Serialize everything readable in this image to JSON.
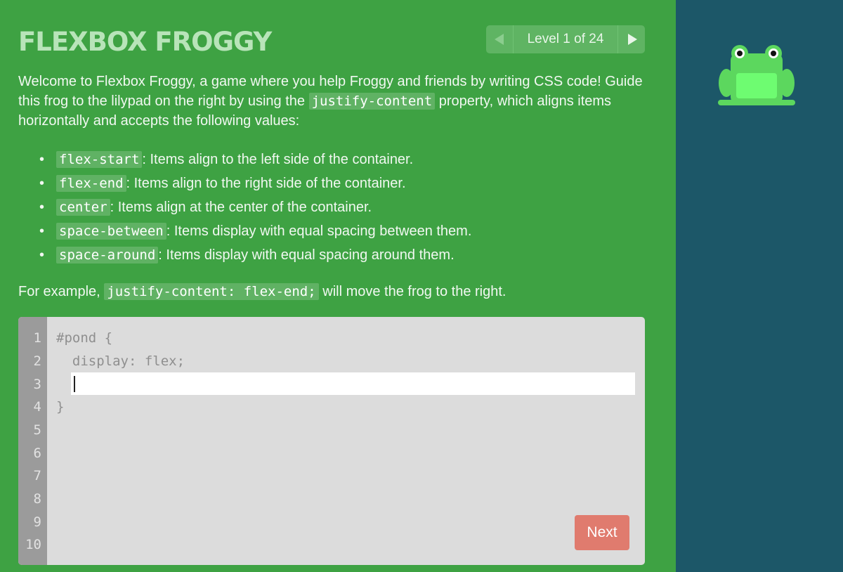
{
  "header": {
    "title": "FLEXBOX FROGGY",
    "level_label": "Level 1 of 24",
    "prev_icon": "triangle-left-icon",
    "next_icon": "triangle-right-icon"
  },
  "instructions": {
    "intro_1": "Welcome to Flexbox Froggy, a game where you help Froggy and friends by writing CSS code! Guide this frog to the lilypad on the right by using the ",
    "intro_code": "justify-content",
    "intro_2": " property, which aligns items horizontally and accepts the following values:",
    "values": [
      {
        "code": "flex-start",
        "text": ": Items align to the left side of the container."
      },
      {
        "code": "flex-end",
        "text": ": Items align to the right side of the container."
      },
      {
        "code": "center",
        "text": ": Items align at the center of the container."
      },
      {
        "code": "space-between",
        "text": ": Items display with equal spacing between them."
      },
      {
        "code": "space-around",
        "text": ": Items display with equal spacing around them."
      }
    ],
    "bullet": "•",
    "example_1": "For example, ",
    "example_code": "justify-content: flex-end;",
    "example_2": " will move the frog to the right."
  },
  "editor": {
    "line_numbers": [
      "1",
      "2",
      "3",
      "4",
      "5",
      "6",
      "7",
      "8",
      "9",
      "10"
    ],
    "line_1": "#pond {",
    "line_2": "  display: flex;",
    "line_4": "}",
    "input_value": "",
    "next_label": "Next"
  },
  "colors": {
    "sidebar_bg": "#3ea243",
    "board_bg": "#1c5768",
    "frog_green": "#5cd75e",
    "next_button": "#e07b6e"
  }
}
